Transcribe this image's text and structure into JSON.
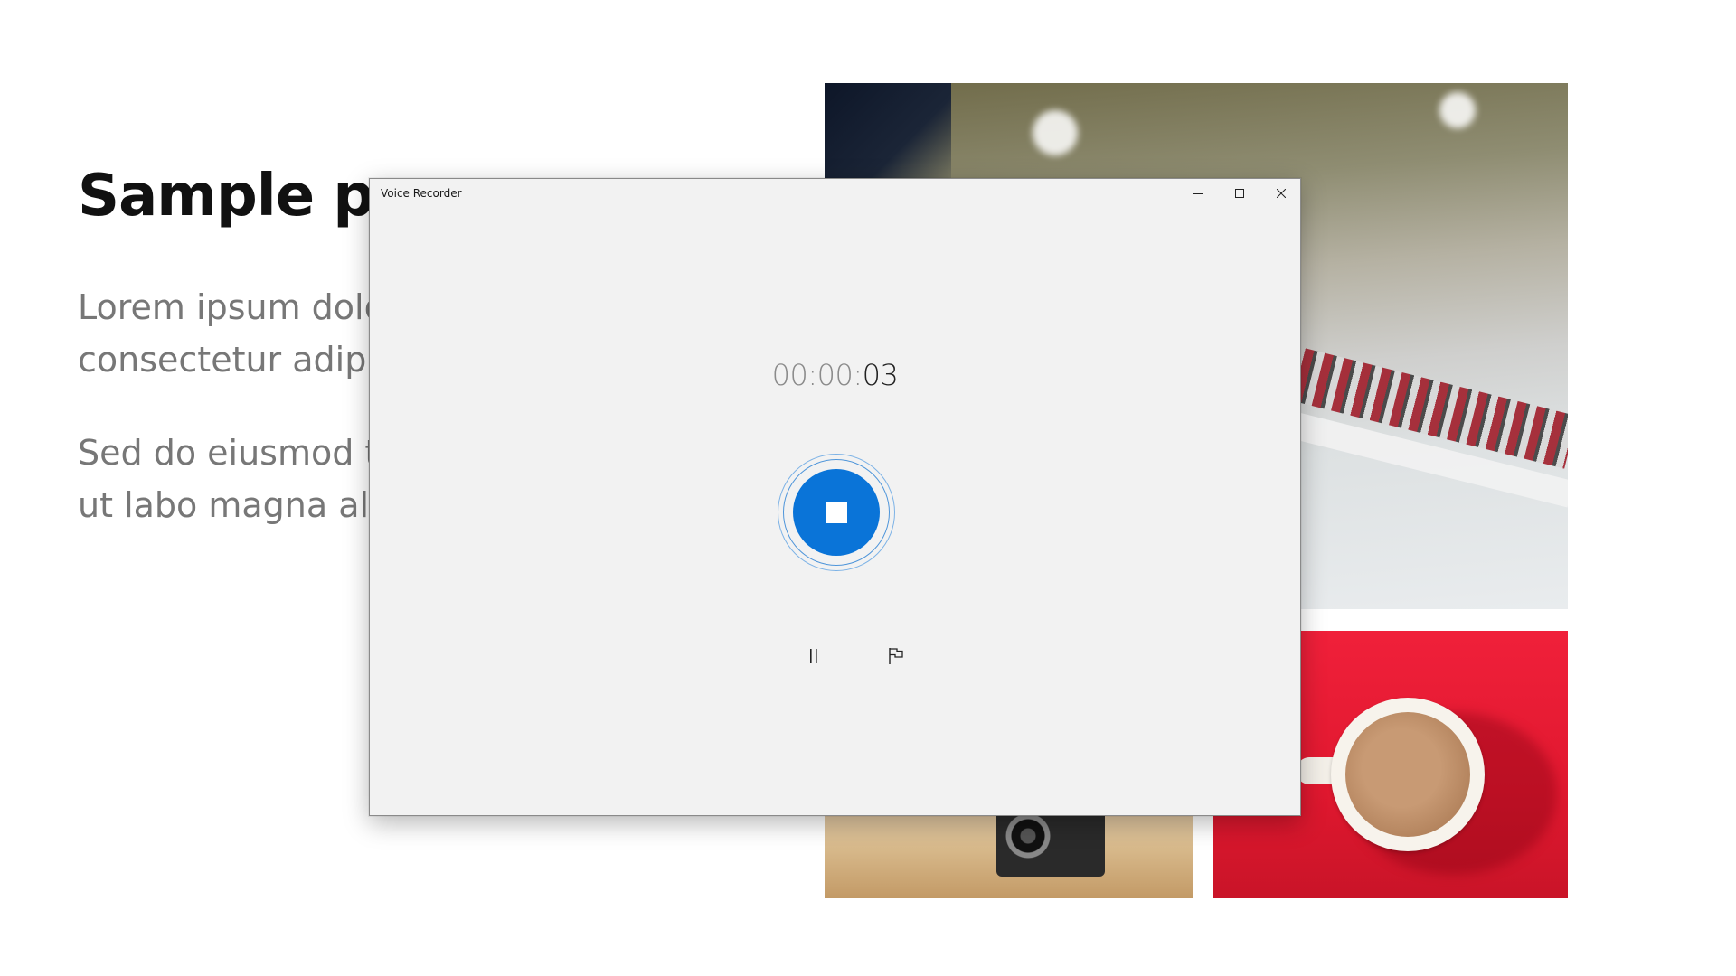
{
  "slide": {
    "title": "Sample pro",
    "paragraph_1": "Lorem ipsum dolo consectetur adipis",
    "paragraph_2": "Sed do eiusmod te incididunt ut labo magna aliqua."
  },
  "window": {
    "title": "Voice Recorder",
    "controls": {
      "minimize": "minimize-icon",
      "maximize": "maximize-icon",
      "close": "close-icon"
    }
  },
  "recorder": {
    "timer_prefix": "00:00:",
    "timer_seconds": "03",
    "stop_icon": "stop-icon",
    "pause_icon": "pause-icon",
    "marker_icon": "flag-icon"
  },
  "colors": {
    "accent": "#0a74d8",
    "window_bg": "#f2f2f2",
    "slide_text": "#777777"
  }
}
